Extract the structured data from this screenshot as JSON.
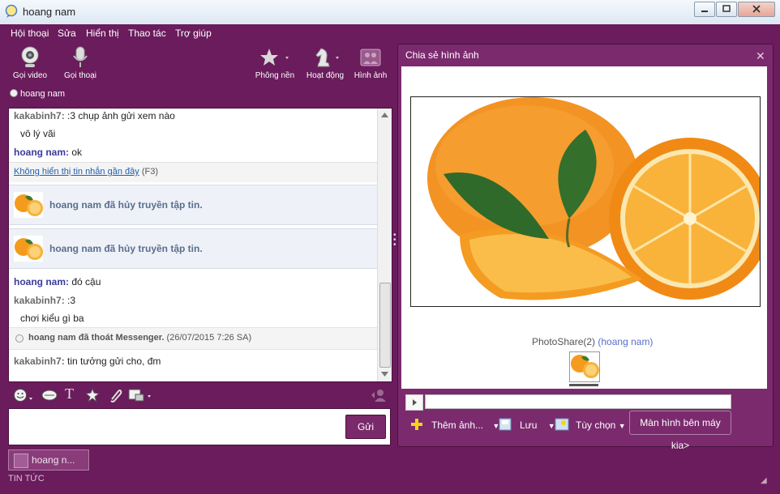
{
  "window": {
    "title": "hoang nam"
  },
  "menu": [
    "Hội thoại",
    "Sửa",
    "Hiển thị",
    "Thao tác",
    "Trợ giúp"
  ],
  "toolbar": {
    "video_call": "Gọi video",
    "voice_call": "Gọi thoại",
    "background": "Phông nền",
    "activities": "Hoạt động",
    "pictures": "Hình ảnh"
  },
  "status": {
    "name": "hoang nam"
  },
  "chat": {
    "m1_sender": "kakabinh7:",
    "m1_text": ":3 chụp ảnh gửi xem nào",
    "m2_text": "vô lý vãi",
    "m3_sender": "hoang nam:",
    "m3_text": "ok",
    "hide_link": "Không hiển thị tin nhắn gần đây",
    "hide_shortcut": "(F3)",
    "notice1": "hoang nam đã hủy truyền tập tin.",
    "notice2": "hoang nam đã hủy truyền tập tin.",
    "m4_sender": "hoang nam:",
    "m4_text": "đó cậu",
    "m5_sender": "kakabinh7:",
    "m5_text": ":3",
    "m6_text": "chơi kiểu gì ba",
    "logout_text": "hoang nam đã thoát Messenger.",
    "logout_time": "(26/07/2015 7:26 SA)",
    "m7_sender": "kakabinh7:",
    "m7_text": "tin tưởng gửi cho, đm"
  },
  "input": {
    "send_label": "Gửi"
  },
  "photo_share": {
    "title": "Chia sẻ hình ảnh",
    "caption": "PhotoShare(2)",
    "caption_user": "(hoang nam)",
    "add_photo": "Thêm ảnh...",
    "save": "Lưu",
    "options": "Tùy chọn",
    "remote_screen": "Màn hình bên máy kia>"
  },
  "bottom": {
    "tab_label": "hoang n...",
    "news": "TIN TỨC"
  },
  "colors": {
    "frame": "#6a1c5c",
    "panel": "#7b2a6e",
    "link": "#1f5fae"
  },
  "icons": [
    "webcam-icon",
    "microphone-icon",
    "background-icon",
    "chess-knight-icon",
    "pictures-icon",
    "smiley-icon",
    "nudge-icon",
    "font-icon",
    "wink-icon",
    "attach-icon",
    "share-icon",
    "contact-icon"
  ]
}
